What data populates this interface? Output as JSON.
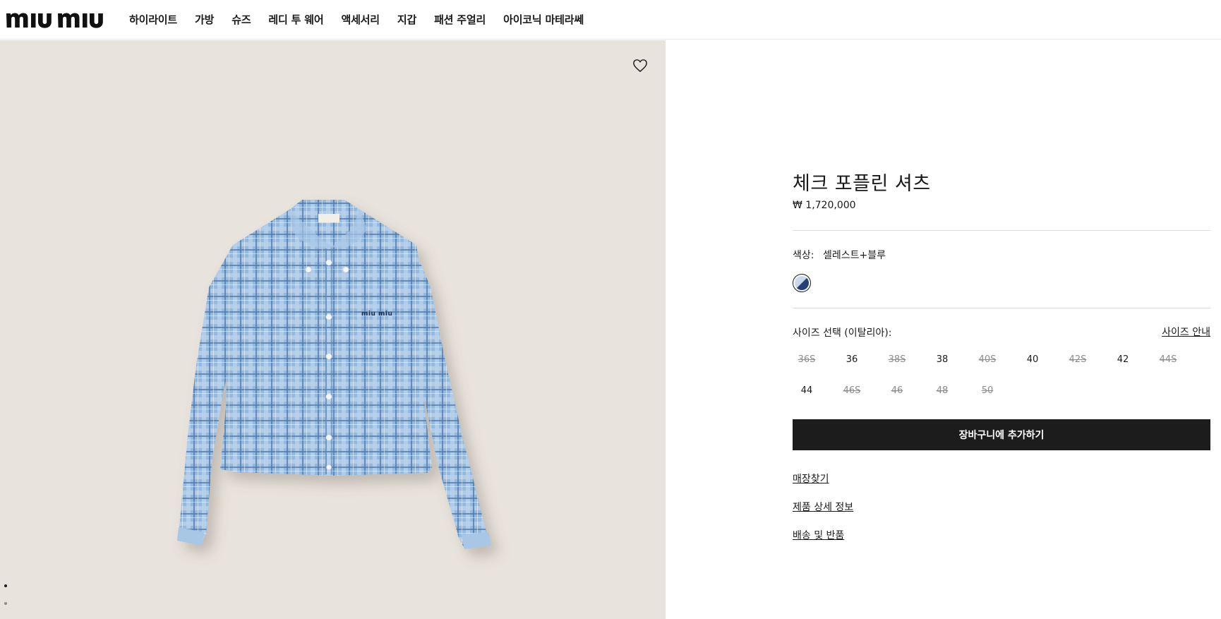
{
  "brand": {
    "logo_text": "miu miu"
  },
  "nav": {
    "items": [
      "하이라이트",
      "가방",
      "슈즈",
      "레디 투 웨어",
      "액세서리",
      "지갑",
      "패션 주얼리",
      "아이코닉 마테라쎄"
    ]
  },
  "product": {
    "image_icon": "shirt-photo",
    "shirt_brand_embroidery": "miu miu",
    "wishlist_icon": "heart-icon",
    "gallery_dots": {
      "count": 2,
      "active": 1
    },
    "title": "체크 포플린 셔츠",
    "price": "₩ 1,720,000",
    "color_label": "색상:",
    "color_value": "셀레스트+블루",
    "size_label": "사이즈 선택 (이탈리아):",
    "size_guide": "사이즈 안내",
    "sizes": [
      {
        "label": "36S",
        "available": false
      },
      {
        "label": "36",
        "available": true
      },
      {
        "label": "38S",
        "available": false
      },
      {
        "label": "38",
        "available": true
      },
      {
        "label": "40S",
        "available": false
      },
      {
        "label": "40",
        "available": true
      },
      {
        "label": "42S",
        "available": false
      },
      {
        "label": "42",
        "available": true
      },
      {
        "label": "44S",
        "available": false
      },
      {
        "label": "44",
        "available": true
      },
      {
        "label": "46S",
        "available": false
      },
      {
        "label": "46",
        "available": false
      },
      {
        "label": "48",
        "available": false
      },
      {
        "label": "50",
        "available": false
      }
    ],
    "add_to_cart": "장바구니에 추가하기",
    "links": [
      "매장찾기",
      "제품 상세 정보",
      "배송 및 반품"
    ]
  },
  "colors": {
    "background_photo": "#e8e3dc",
    "button": "#1c1c1c",
    "shirt_blue": "#8fb5dc"
  }
}
